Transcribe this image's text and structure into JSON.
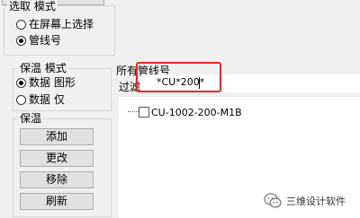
{
  "selection_mode": {
    "title": "选取 模式",
    "options": [
      "在屏幕上选择",
      "管线号"
    ],
    "selected_index": 1
  },
  "insulation_mode": {
    "title": "保温 模式",
    "options": [
      "数据 图形",
      "数据 仅"
    ],
    "selected_index": 0
  },
  "insulation": {
    "title": "保温",
    "buttons": [
      "添加",
      "更改",
      "移除",
      "刷新"
    ]
  },
  "all_lines": {
    "title": "所有管线号",
    "filter_label": "过滤",
    "filter_value": "*CU*200*",
    "tree_items": [
      "CU-1002-200-M1B"
    ]
  },
  "watermark": {
    "text": "三维设计软件",
    "icon": "wechat-icon"
  },
  "colors": {
    "highlight": "#e8262a"
  }
}
